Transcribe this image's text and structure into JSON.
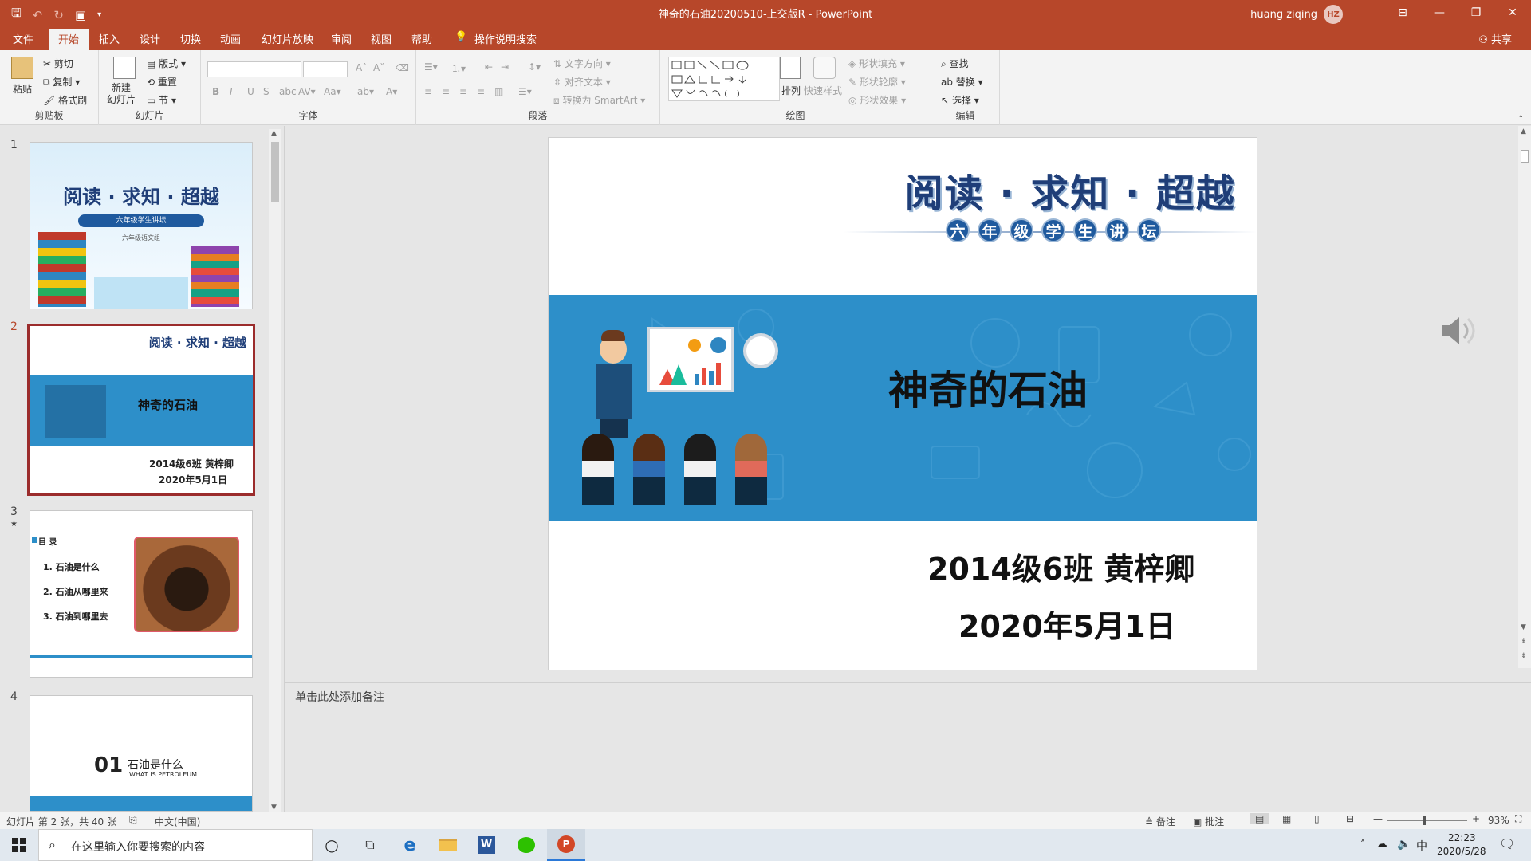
{
  "titlebar": {
    "doc_title": "神奇的石油20200510-上交版R  -  PowerPoint",
    "user_name": "huang ziqing",
    "user_initials": "HZ"
  },
  "tabs": [
    "文件",
    "开始",
    "插入",
    "设计",
    "切换",
    "动画",
    "幻灯片放映",
    "审阅",
    "视图",
    "帮助",
    "操作说明搜索"
  ],
  "share_label": "共享",
  "ribbon": {
    "clipboard": {
      "paste": "粘贴",
      "cut": "剪切",
      "copy": "复制",
      "format_painter": "格式刷",
      "label": "剪贴板"
    },
    "slides": {
      "new_slide": "新建\n幻灯片",
      "layout": "版式",
      "reset": "重置",
      "section": "节",
      "label": "幻灯片"
    },
    "font": {
      "label": "字体"
    },
    "paragraph": {
      "text_direction": "文字方向",
      "align_text": "对齐文本",
      "smartart": "转换为 SmartArt",
      "label": "段落"
    },
    "drawing": {
      "arrange": "排列",
      "quick_styles": "快速样式",
      "shape_fill": "形状填充",
      "shape_outline": "形状轮廓",
      "shape_effects": "形状效果",
      "label": "绘图"
    },
    "editing": {
      "find": "查找",
      "replace": "替换",
      "select": "选择",
      "label": "编辑"
    }
  },
  "thumbnails": [
    {
      "num": "1",
      "title": "阅读 · 求知 · 超越",
      "subtitle": "六年级学生讲坛",
      "note": "六年级语文组"
    },
    {
      "num": "2",
      "header": "阅读 · 求知 · 超越",
      "title": "神奇的石油",
      "line1": "2014级6班  黄梓卿",
      "line2": "2020年5月1日"
    },
    {
      "num": "3",
      "heading": "目 录",
      "items": [
        "1. 石油是什么",
        "2. 石油从哪里来",
        "3. 石油到哪里去"
      ]
    },
    {
      "num": "4",
      "big": "01",
      "title": "石油是什么",
      "subtitle": "WHAT IS PETROLEUM"
    }
  ],
  "slide": {
    "header_title": "阅读 · 求知 · 超越",
    "header_sub": [
      "六",
      "年",
      "级",
      "学",
      "生",
      "讲",
      "坛"
    ],
    "title": "神奇的石油",
    "class_line": "2014级6班  黄梓卿",
    "date_line": "2020年5月1日"
  },
  "notes_placeholder": "单击此处添加备注",
  "status": {
    "slide_info": "幻灯片 第 2 张，共 40 张",
    "language": "中文(中国)",
    "notes_btn": "备注",
    "comments_btn": "批注",
    "zoom": "93%"
  },
  "taskbar": {
    "search_placeholder": "在这里输入你要搜索的内容",
    "time": "22:23",
    "date": "2020/5/28",
    "ime": "中"
  },
  "colors": {
    "accent": "#b7472a",
    "banner": "#2d8fc9",
    "title_blue": "#1f3e78"
  }
}
